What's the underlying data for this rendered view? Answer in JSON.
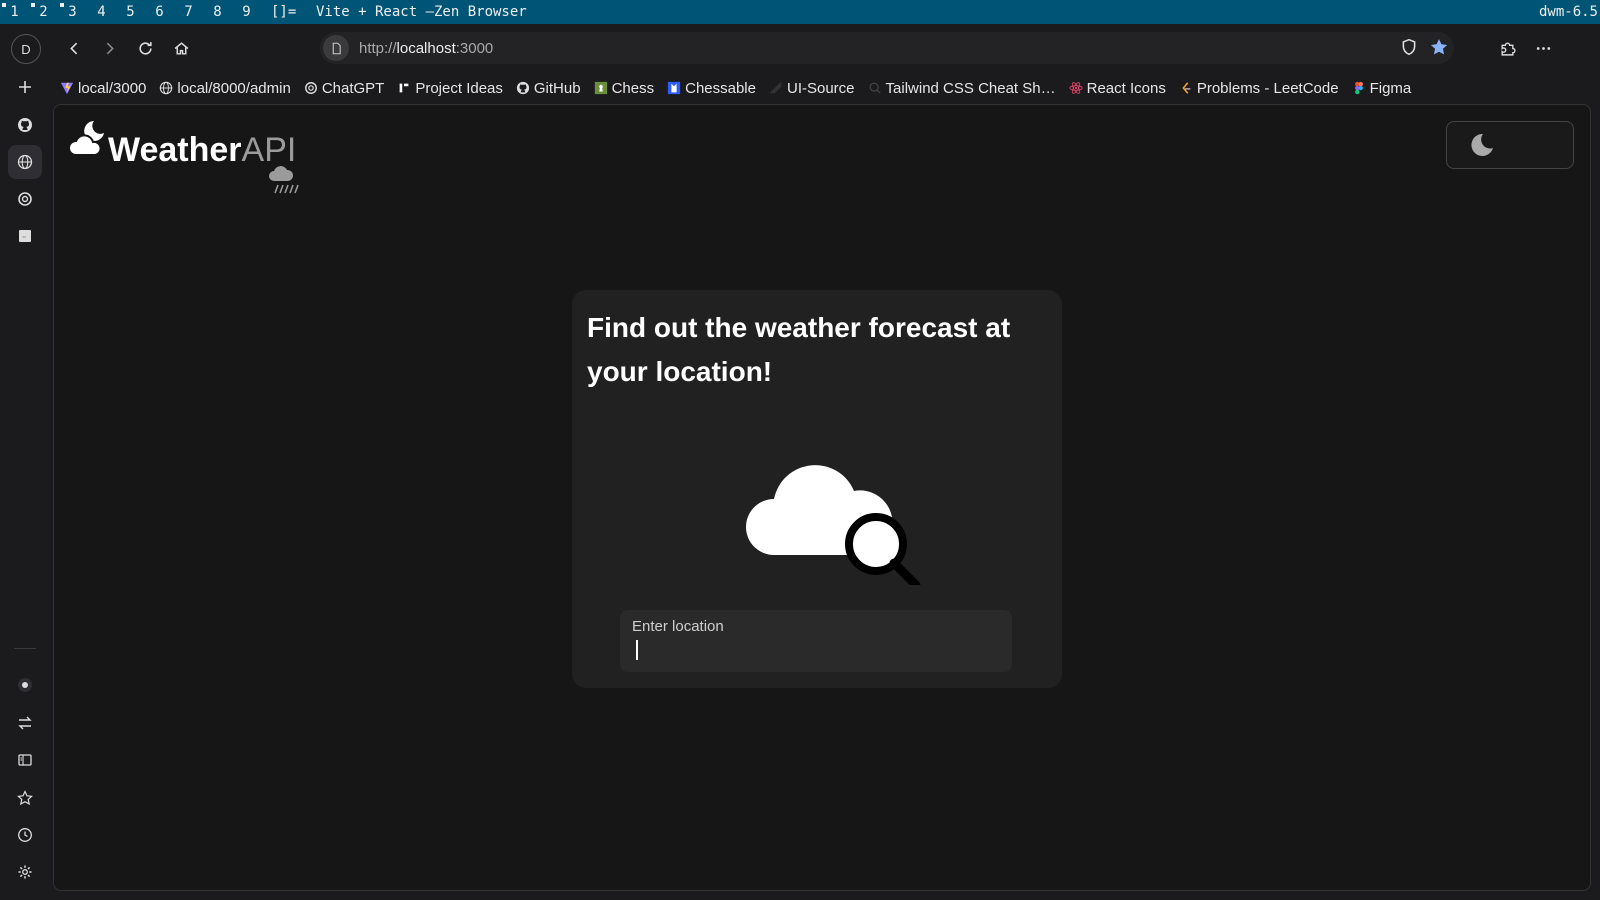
{
  "dwm": {
    "tags": [
      "1",
      "2",
      "3",
      "4",
      "5",
      "6",
      "7",
      "8",
      "9"
    ],
    "layout": "[]=",
    "window_title": "Vite + React —Zen Browser",
    "status": "dwm-6.5"
  },
  "browser": {
    "profile_initial": "D",
    "url_proto": "http://",
    "url_host": "localhost",
    "url_port": ":3000",
    "bookmarks": [
      {
        "label": "local/3000",
        "icon": "vite-icon"
      },
      {
        "label": "local/8000/admin",
        "icon": "globe-icon"
      },
      {
        "label": "ChatGPT",
        "icon": "openai-icon"
      },
      {
        "label": "Project Ideas",
        "icon": "roadmap-icon"
      },
      {
        "label": "GitHub",
        "icon": "github-icon"
      },
      {
        "label": "Chess",
        "icon": "chess-icon"
      },
      {
        "label": "Chessable",
        "icon": "chessable-icon"
      },
      {
        "label": "UI-Source",
        "icon": "uisource-icon"
      },
      {
        "label": "Tailwind CSS Cheat Sh…",
        "icon": "search-icon"
      },
      {
        "label": "React Icons",
        "icon": "react-icon"
      },
      {
        "label": "Problems - LeetCode",
        "icon": "leetcode-icon"
      },
      {
        "label": "Figma",
        "icon": "figma-icon"
      }
    ]
  },
  "app": {
    "logo_word1": "Weather",
    "logo_word2": "API",
    "headline": "Find out the weather forecast at your location!",
    "location_label": "Enter location",
    "location_value": ""
  },
  "colors": {
    "dwm_bar": "#005577",
    "page_bg": "#161616",
    "card_bg": "#212121",
    "input_bg": "#2a2a2a",
    "accent_star": "#8ab4f8"
  }
}
